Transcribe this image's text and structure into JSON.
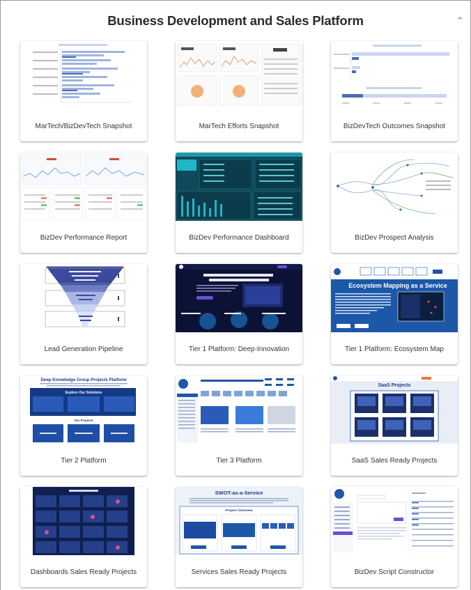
{
  "section": {
    "title": "Business Development and Sales Platform",
    "collapse_icon": "chevron-up-icon"
  },
  "cards": [
    {
      "label": "MarTech/BizDevTech Snapshot"
    },
    {
      "label": "MarTech Efforts Snapshot"
    },
    {
      "label": "BizDevTech Outcomes Snapshot"
    },
    {
      "label": "BizDev Performance Report"
    },
    {
      "label": "BizDev Performance Dashboard"
    },
    {
      "label": "BizDev Prospect Analysis"
    },
    {
      "label": "Lead Generation Pipeline"
    },
    {
      "label": "Tier 1 Platform: Deep-Innovation"
    },
    {
      "label": "Tier 1 Platform: Ecosystem Map"
    },
    {
      "label": "Tier 2 Platform"
    },
    {
      "label": "Tier 3 Platform"
    },
    {
      "label": "SaaS Sales Ready Projects"
    },
    {
      "label": "Dashboards Sales Ready Projects"
    },
    {
      "label": "Services Sales Ready Projects"
    },
    {
      "label": "BizDev Script Constructor"
    }
  ],
  "thumb_text": {
    "ecosystem_title": "Ecosystem Mapping as a Service",
    "tier2_title": "Deep Knowledge Group Projects Platform",
    "tier2_explore": "Explore Our Solutions",
    "tier2_projects": "Our Projects",
    "saas_title": "SaaS Projects",
    "swot_title": "SWOT-as-a-Service",
    "swot_overview": "Project Overview"
  }
}
